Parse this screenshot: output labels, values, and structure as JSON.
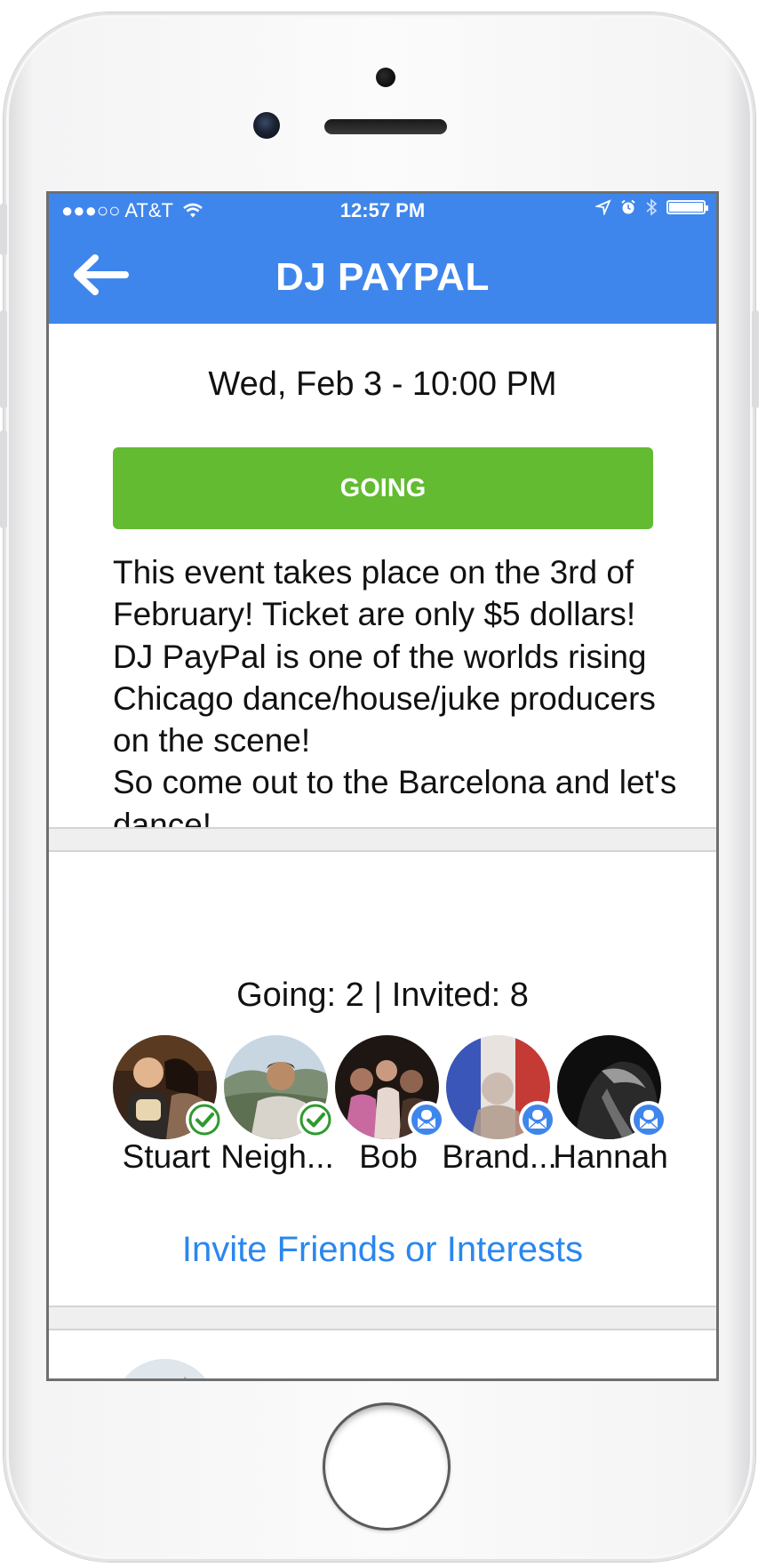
{
  "status_bar": {
    "carrier": "●●●○○ AT&T",
    "time": "12:57 PM"
  },
  "nav": {
    "title": "DJ PAYPAL"
  },
  "event": {
    "date_time": "Wed, Feb 3 - 10:00 PM",
    "rsvp_label": "GOING",
    "description": [
      "This event takes place on the 3rd of February! Ticket are only $5 dollars!",
      "DJ PayPal is one of the worlds rising Chicago dance/house/juke producers on the scene!",
      "So come out to the Barcelona and let's dance!"
    ]
  },
  "attendance": {
    "summary": "Going: 2 | Invited: 8",
    "attendees": [
      {
        "name": "Stuart",
        "status": "going",
        "badge_icon": "check-icon"
      },
      {
        "name": "Neigh...",
        "status": "going",
        "badge_icon": "check-icon"
      },
      {
        "name": "Bob",
        "status": "invited",
        "badge_icon": "envelope-icon"
      },
      {
        "name": "Brand...",
        "status": "invited",
        "badge_icon": "envelope-icon"
      },
      {
        "name": "Hannah",
        "status": "invited",
        "badge_icon": "envelope-icon"
      }
    ],
    "invite_label": "Invite Friends or Interests"
  },
  "colors": {
    "primary_blue": "#3f86ec",
    "going_green": "#62bb30",
    "link_blue": "#2a87ee",
    "check_green": "#2e9a2e"
  }
}
